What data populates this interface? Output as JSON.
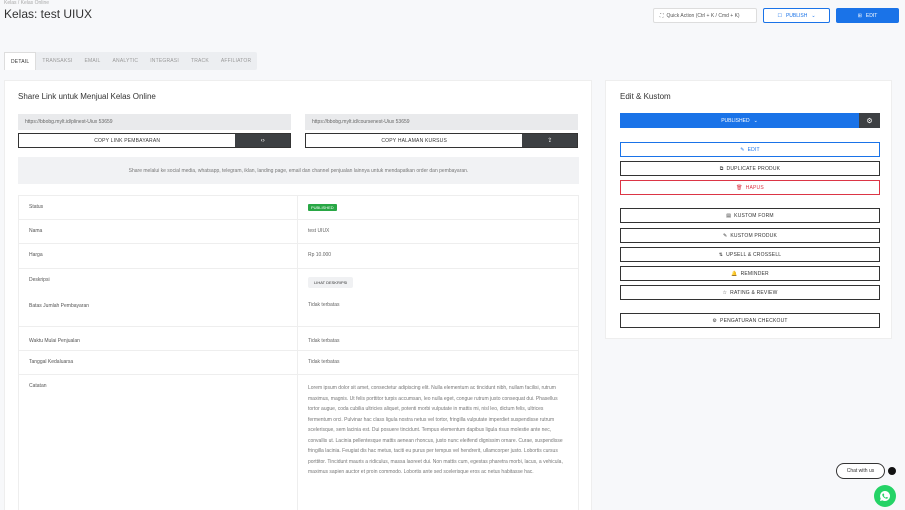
{
  "breadcrumb": "Kelas / Kelas Online",
  "page_title": "Kelas: test UIUX",
  "top_actions": {
    "quick_action": "Quick Action (Ctrl + K / Cmd + K)",
    "published": "PUBLISH",
    "edit": "EDIT"
  },
  "tabs": [
    "DETAIL",
    "TRANSAKSI",
    "EMAIL",
    "ANALYTIC",
    "INTEGRASI",
    "TRACK",
    "AFFILIATOR"
  ],
  "share": {
    "title": "Share Link untuk Menjual Kelas Online",
    "url_payment": "https://bbobg.mylt.id/plinest-Uiux 53659",
    "url_course": "https://bbobg.mylt.id/coursenest-Uiux 53659",
    "copy_payment": "COPY LINK PEMBAYARAN",
    "show_course": "COPY HALAMAN KURSUS",
    "note": "Share melalui ke social media, whatsapp, telegram, iklan, landing page, email dan channel penjualan lainnya untuk mendapatkan order dan pembayaran."
  },
  "details": {
    "status_label": "Status",
    "status_value": "PUBLISHED",
    "name_label": "Nama",
    "name_value": "test UIUX",
    "price_label": "Harga",
    "price_value": "Rp 10.000",
    "desc_label": "Deskripsi",
    "desc_value": "LIHAT DESKRIPSI",
    "limit_label": "Batas Jumlah Pembayaran",
    "limit_value": "Tidak terbatas",
    "time_label": "Waktu Mulai Penjualan",
    "time_value": "Tidak terbatas",
    "expire_label": "Tanggal Kedaluarsa",
    "expire_value": "Tidak terbatas",
    "notes_label": "Catatan",
    "notes_value": "Lorem ipsum dolor sit amet, consectetur adipiscing elit. Nulla elementum ac tincidunt nibh, nullam facilisi, rutrum maximus, magnis. Ut felis porttitor turpis accumsan, leo nulla eget, congue rutrum justo consequat dui. Phasellus tortor augue, coda cubilia ultricies aliquet, potenti morbi vulputate in mattis mi, nisl leo, dictum felis, ultrices fermentum orci. Pulvinar hac class ligula nostra netus vel tortor, fringilla vulputate imperdiet suspendisse rutrum scelerisque, sem lacinia est. Dui posuere tincidunt. Tempus elementum dapibus ligula risus molestie ante nec, convallis ut. Lacinia pellentesque mattis aenean rhoncus, justo nunc eleifend dignissim ornare. Curae, suspendisse fringilla lacinia. Feugiat dis hac metus, taciti eu purus per tempus vel hendrerit, ullamcorper justo. Lobortis cursus porttitor. Tincidunt mauris a ridiculus, massa laoreet dui. Non mattis cum, egestas pharetra morbi, lacus, a vehicula, maximus sapien auctor et proin commodo. Lobortis ante sed scelerisque eros ac netus habitasse hac."
  },
  "panel": {
    "title": "Edit & Kustom",
    "published": "PUBLISHED",
    "actions": {
      "edit": "EDIT",
      "duplicate": "DUPLICATE PRODUK",
      "delete": "HAPUS",
      "form": "KUSTOM FORM",
      "produk": "KUSTOM PRODUK",
      "upsell": "UPSELL & CROSSELL",
      "reminder": "REMINDER",
      "rating": "RATING & REVIEW",
      "checkout": "PENGATURAN CHECKOUT"
    }
  },
  "chat": {
    "label": "Chat with us"
  },
  "colors": {
    "primary": "#1a73e8",
    "dark": "#3d4043",
    "danger": "#dc3545",
    "success": "#28a745",
    "whatsapp": "#25d366"
  }
}
